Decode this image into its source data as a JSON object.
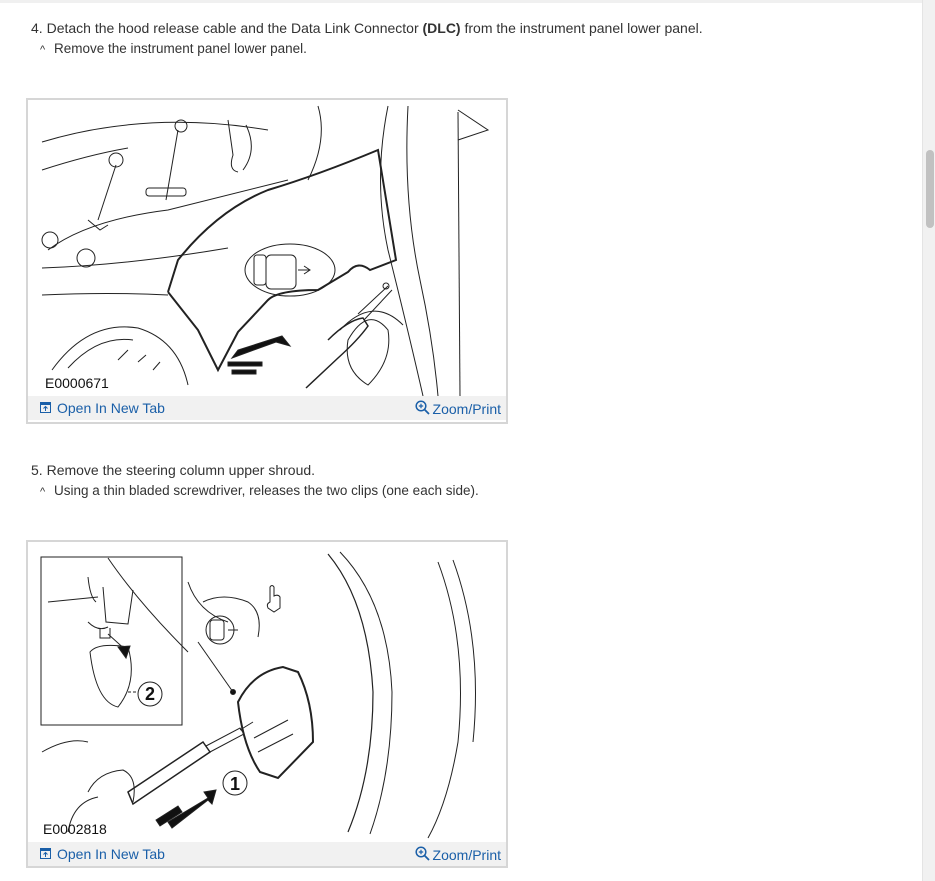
{
  "steps": [
    {
      "number": "4.",
      "text_pre": "Detach the hood release cable and the Data Link Connector ",
      "text_bold": "(DLC)",
      "text_post": " from the instrument panel lower panel.",
      "sub_caret": "^",
      "sub_text": "Remove the instrument panel lower panel.",
      "figure": {
        "code": "E0000671",
        "open_label": "Open In New Tab",
        "zoom_label": "Zoom/Print"
      }
    },
    {
      "number": "5.",
      "text": "Remove the steering column upper shroud.",
      "sub_caret": "^",
      "sub_text": "Using a thin bladed screwdriver, releases the two clips (one each side).",
      "figure": {
        "code": "E0002818",
        "callout_1": "1",
        "callout_2": "2",
        "open_label": "Open In New Tab",
        "zoom_label": "Zoom/Print"
      }
    }
  ],
  "icons": {
    "open": "open-in-new-tab-icon",
    "zoom": "zoom-in-icon"
  },
  "colors": {
    "link": "#1a5fa8",
    "bar_bg": "#f1f1f1",
    "frame": "#d6d6d6",
    "text": "#333333"
  }
}
